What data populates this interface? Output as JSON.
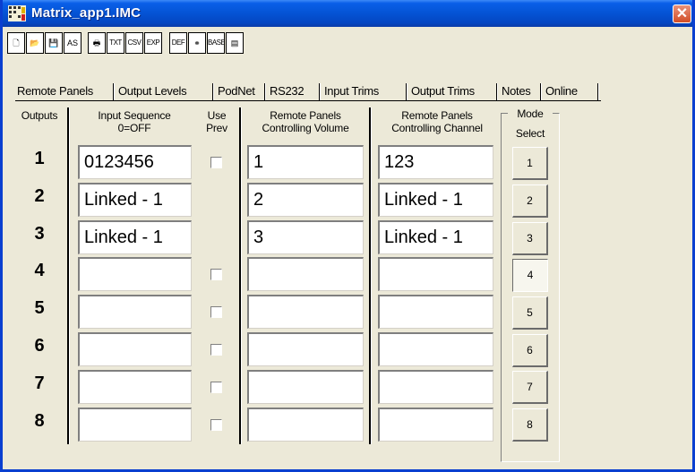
{
  "window": {
    "title": "Matrix_app1.IMC",
    "close_glyph": "✕"
  },
  "toolbar": {
    "buttons": [
      {
        "name": "new-file-icon",
        "glyph": "🗋"
      },
      {
        "name": "open-folder-icon",
        "glyph": "📂"
      },
      {
        "name": "save-icon",
        "glyph": "💾"
      },
      {
        "name": "save-as-icon",
        "glyph": "AS"
      },
      {
        "name": "print-icon",
        "glyph": "🖶"
      },
      {
        "name": "txt-export-icon",
        "label": "TXT"
      },
      {
        "name": "csv-export-icon",
        "label": "CSV"
      },
      {
        "name": "export-icon",
        "label": "EXP"
      },
      {
        "name": "def-icon",
        "label": "DEF"
      },
      {
        "name": "link-icon",
        "glyph": "⚭"
      },
      {
        "name": "base-icon",
        "label": "BASE"
      },
      {
        "name": "device-icon",
        "glyph": "▤"
      }
    ]
  },
  "tabs": [
    "Remote Panels",
    "Output Levels",
    "PodNet",
    "RS232",
    "Input Trims",
    "Output Trims",
    "Notes",
    "Online"
  ],
  "headers": {
    "outputs": "Outputs",
    "input_sequence_1": "Input Sequence",
    "input_sequence_2": "0=OFF",
    "use_prev_1": "Use",
    "use_prev_2": "Prev",
    "rp_volume_1": "Remote Panels",
    "rp_volume_2": "Controlling Volume",
    "rp_channel_1": "Remote Panels",
    "rp_channel_2": "Controlling Channel",
    "mode": "Mode",
    "select": "Select"
  },
  "rows": [
    {
      "num": "1",
      "input_sequence": "0123456",
      "has_checkbox": true,
      "volume": "1",
      "channel": "123",
      "mode_label": "1"
    },
    {
      "num": "2",
      "input_sequence": "Linked - 1",
      "has_checkbox": false,
      "volume": "2",
      "channel": "Linked - 1",
      "mode_label": "2"
    },
    {
      "num": "3",
      "input_sequence": "Linked - 1",
      "has_checkbox": false,
      "volume": "3",
      "channel": "Linked - 1",
      "mode_label": "3"
    },
    {
      "num": "4",
      "input_sequence": "",
      "has_checkbox": true,
      "volume": "",
      "channel": "",
      "mode_label": "4"
    },
    {
      "num": "5",
      "input_sequence": "",
      "has_checkbox": true,
      "volume": "",
      "channel": "",
      "mode_label": "5"
    },
    {
      "num": "6",
      "input_sequence": "",
      "has_checkbox": true,
      "volume": "",
      "channel": "",
      "mode_label": "6"
    },
    {
      "num": "7",
      "input_sequence": "",
      "has_checkbox": true,
      "volume": "",
      "channel": "",
      "mode_label": "7"
    },
    {
      "num": "8",
      "input_sequence": "",
      "has_checkbox": true,
      "volume": "",
      "channel": "",
      "mode_label": "8"
    }
  ],
  "mode_selected": "4",
  "colors": {
    "titlebar": "#0453d4",
    "close": "#d24d26",
    "face": "#ece9d8"
  }
}
